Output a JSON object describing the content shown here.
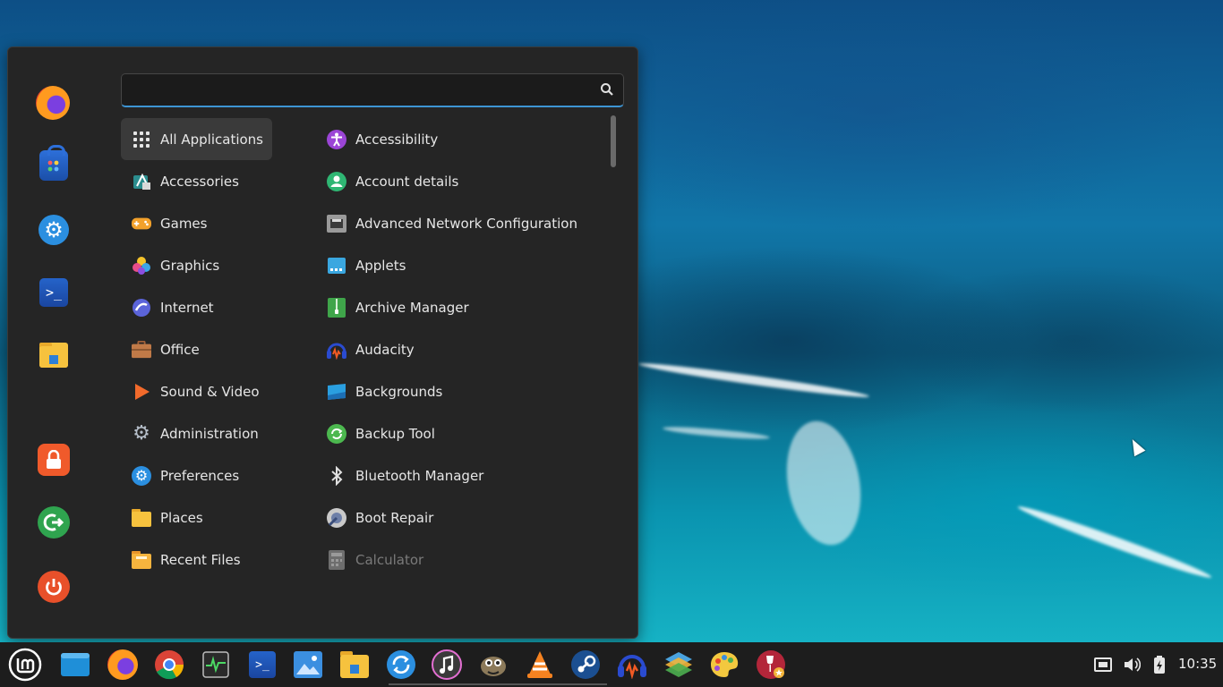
{
  "search": {
    "value": "",
    "placeholder": ""
  },
  "favorites": [
    {
      "name": "firefox-icon"
    },
    {
      "name": "software-manager-icon"
    },
    {
      "name": "system-settings-icon"
    },
    {
      "name": "terminal-icon"
    },
    {
      "name": "files-icon"
    },
    {
      "name": "lock-screen-icon"
    },
    {
      "name": "logout-icon"
    },
    {
      "name": "shutdown-icon"
    }
  ],
  "categories": [
    {
      "label": "All Applications",
      "icon": "all-applications-icon",
      "active": true
    },
    {
      "label": "Accessories",
      "icon": "accessories-icon"
    },
    {
      "label": "Games",
      "icon": "games-icon"
    },
    {
      "label": "Graphics",
      "icon": "graphics-icon"
    },
    {
      "label": "Internet",
      "icon": "internet-icon"
    },
    {
      "label": "Office",
      "icon": "office-icon"
    },
    {
      "label": "Sound & Video",
      "icon": "sound-video-icon"
    },
    {
      "label": "Administration",
      "icon": "administration-icon"
    },
    {
      "label": "Preferences",
      "icon": "preferences-icon"
    },
    {
      "label": "Places",
      "icon": "places-icon"
    },
    {
      "label": "Recent Files",
      "icon": "recent-files-icon"
    }
  ],
  "apps": [
    {
      "label": "Accessibility",
      "icon": "accessibility-icon"
    },
    {
      "label": "Account details",
      "icon": "account-details-icon"
    },
    {
      "label": "Advanced Network Configuration",
      "icon": "network-config-icon"
    },
    {
      "label": "Applets",
      "icon": "applets-icon"
    },
    {
      "label": "Archive Manager",
      "icon": "archive-manager-icon"
    },
    {
      "label": "Audacity",
      "icon": "audacity-icon"
    },
    {
      "label": "Backgrounds",
      "icon": "backgrounds-icon"
    },
    {
      "label": "Backup Tool",
      "icon": "backup-tool-icon"
    },
    {
      "label": "Bluetooth Manager",
      "icon": "bluetooth-icon"
    },
    {
      "label": "Boot Repair",
      "icon": "boot-repair-icon"
    },
    {
      "label": "Calculator",
      "icon": "calculator-icon",
      "dim": true
    }
  ],
  "taskbar": {
    "apps": [
      "mint-menu-icon",
      "show-desktop-icon",
      "firefox-icon",
      "chrome-icon",
      "system-monitor-icon",
      "terminal-icon",
      "image-viewer-icon",
      "files-icon",
      "update-manager-icon",
      "rhythmbox-icon",
      "gimp-icon",
      "vlc-icon",
      "steam-icon",
      "audacity-icon",
      "layers-icon",
      "color-palette-icon",
      "wine-icon"
    ],
    "tray": [
      "network-icon",
      "volume-icon",
      "battery-icon"
    ],
    "clock": "10:35"
  },
  "colors": {
    "accent": "#3d95d4",
    "menu_bg": "#252525",
    "panel_bg": "#1d1d1d"
  }
}
